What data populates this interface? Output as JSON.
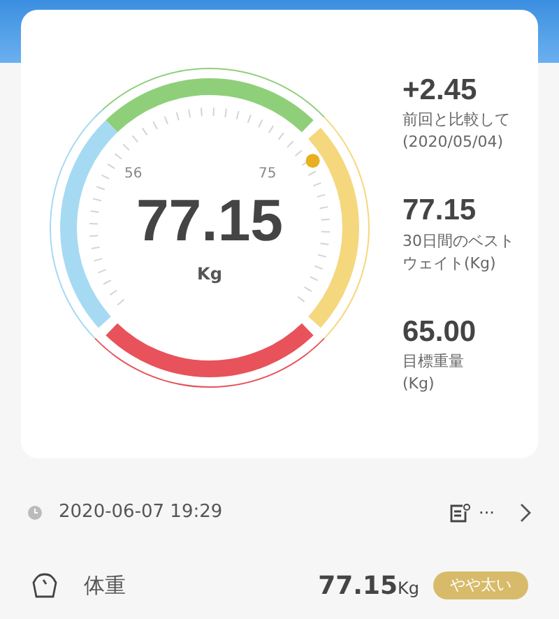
{
  "gauge": {
    "value": "77.15",
    "unit": "Kg",
    "min_label": "56",
    "max_label": "75",
    "segments": [
      {
        "color": "#8fcf7a"
      },
      {
        "color": "#f5d77d"
      },
      {
        "color": "#e8525a"
      },
      {
        "color": "#a6daf2"
      }
    ]
  },
  "stats": [
    {
      "value": "+2.45",
      "lines": [
        "前回と比較して",
        "(2020/05/04)"
      ]
    },
    {
      "value": "77.15",
      "lines": [
        "30日間のベスト",
        "ウェイト(Kg)"
      ]
    },
    {
      "value": "65.00",
      "lines": [
        "目標重量",
        "(Kg)"
      ]
    }
  ],
  "record": {
    "datetime": "2020-06-07 19:29",
    "more": "···"
  },
  "metric": {
    "name": "体重",
    "value": "77.15",
    "unit": "Kg",
    "badge": "やや太い"
  }
}
